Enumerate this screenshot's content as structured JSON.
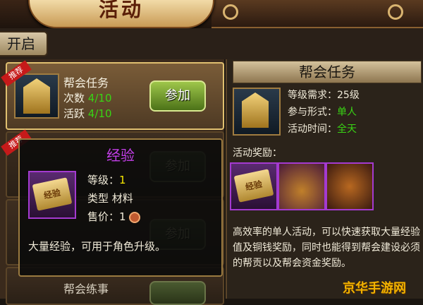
{
  "header": {
    "title": "活动"
  },
  "tab": {
    "label": "开启"
  },
  "ribbon": {
    "label": "推荐"
  },
  "list": {
    "card1": {
      "title": "帮会任务",
      "count_label": "次数",
      "count_value": "4/10",
      "active_label": "活跃",
      "active_value": "4/10",
      "join_label": "参加"
    },
    "join_dim_1": "参加",
    "join_dim_2": "参加",
    "card4_title": "帮会练事"
  },
  "popup": {
    "title": "经验",
    "level_label": "等级：",
    "level_value": "1",
    "type_label": "类型",
    "type_value": "材料",
    "price_label": "售价：",
    "price_value": "1",
    "item_text": "经验",
    "description": "大量经验，可用于角色升级。"
  },
  "detail": {
    "title": "帮会任务",
    "level_req": "等级需求：25级",
    "form_label": "参与形式：",
    "form_value": "单人",
    "time_label": "活动时间：",
    "time_value": "全天",
    "reward_label": "活动奖励：",
    "reward1_text": "经验",
    "description": "高效率的单人活动，可以快速获取大量经验值及铜钱奖励，同时也能得到帮会建设必须的帮贡以及帮会资金奖励。"
  },
  "watermark": "京华手游网",
  "colors": {
    "accent_green": "#39d414",
    "rare_purple": "#c33ee8",
    "value_yellow": "#f5e600"
  }
}
